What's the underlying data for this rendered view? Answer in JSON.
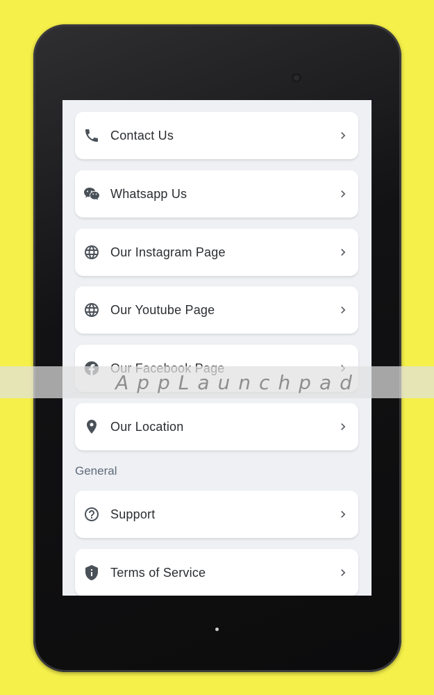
{
  "menu": {
    "items": [
      {
        "label": "Contact Us",
        "icon": "phone-icon"
      },
      {
        "label": "Whatsapp Us",
        "icon": "chat-icon"
      },
      {
        "label": "Our Instagram Page",
        "icon": "globe-icon"
      },
      {
        "label": "Our Youtube Page",
        "icon": "globe-icon"
      },
      {
        "label": "Our Facebook Page",
        "icon": "facebook-icon"
      },
      {
        "label": "Our Location",
        "icon": "location-pin-icon"
      }
    ]
  },
  "general": {
    "title": "General",
    "items": [
      {
        "label": "Support",
        "icon": "help-circle-icon"
      },
      {
        "label": "Terms of Service",
        "icon": "shield-info-icon"
      }
    ]
  },
  "watermark": {
    "text": "AppLaunchpad"
  },
  "colors": {
    "background": "#f5f04a",
    "screen": "#eef0f4",
    "card": "#ffffff",
    "icon": "#4a5158"
  }
}
